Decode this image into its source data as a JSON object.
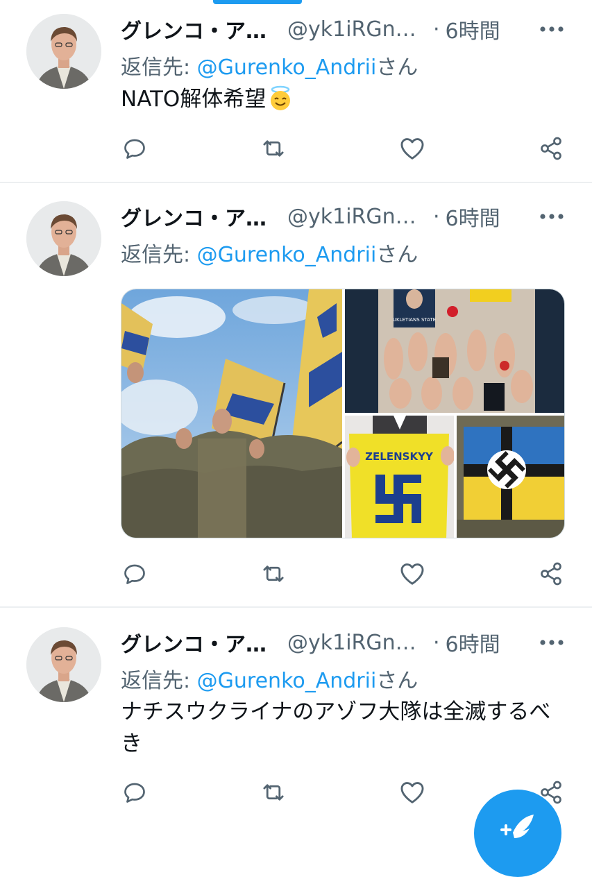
{
  "tweets": [
    {
      "author_name": "グレンコ・ア…",
      "author_handle": "@yk1iRGnH…",
      "separator": "·",
      "time": "6時間",
      "reply_label": "返信先: ",
      "reply_to": "@Gurenko_Andrii",
      "reply_suffix": "さん",
      "text": "NATO解体希望",
      "emoji": "smiling-face-with-halo-icon"
    },
    {
      "author_name": "グレンコ・ア…",
      "author_handle": "@yk1iRGnH…",
      "separator": "·",
      "time": "6時間",
      "reply_label": "返信先: ",
      "reply_to": "@Gurenko_Andrii",
      "reply_suffix": "さん",
      "media": {
        "photo_1": "photo of uniformed marchers with blue-and-yellow flags",
        "photo_2_caption": "UKLETIANS STATE",
        "photo_3_shirt_text": "ZELENSKYY",
        "photo_4": "flag photo"
      }
    },
    {
      "author_name": "グレンコ・ア…",
      "author_handle": "@yk1iRGnH…",
      "separator": "·",
      "time": "6時間",
      "reply_label": "返信先: ",
      "reply_to": "@Gurenko_Andrii",
      "reply_suffix": "さん",
      "text": "ナチスウクライナのアゾフ大隊は全滅するべき"
    }
  ],
  "actions": [
    "reply-icon",
    "retweet-icon",
    "like-icon",
    "share-icon"
  ],
  "colors": {
    "accent": "#1d9bf0",
    "secondary_text": "#536471",
    "divider": "#eceff1"
  },
  "fab": {
    "icon": "compose-tweet-icon"
  }
}
